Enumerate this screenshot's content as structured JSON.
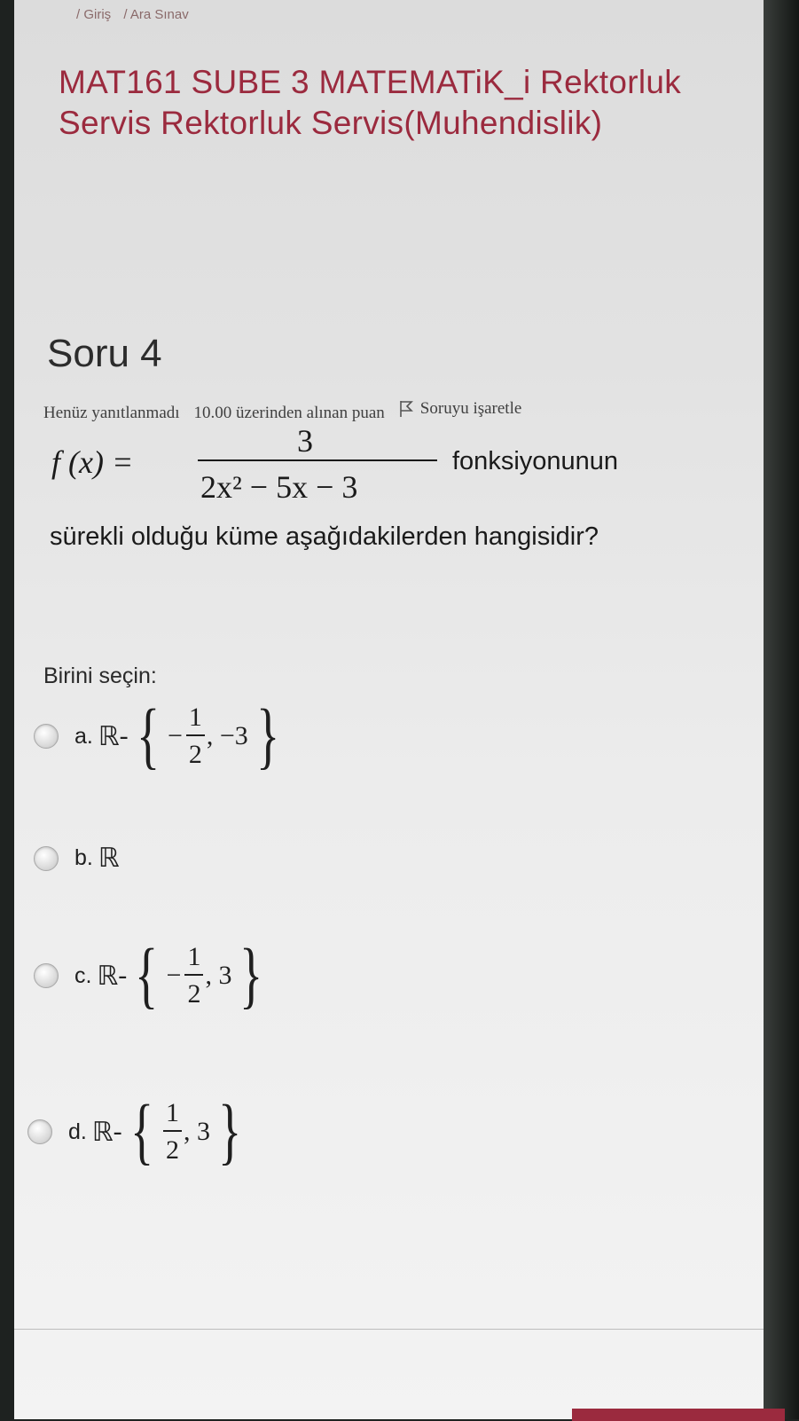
{
  "breadcrumb": {
    "items": [
      "/ Giriş",
      "/ Ara Sınav"
    ]
  },
  "course": {
    "title": "MAT161 SUBE 3 MATEMATiK_i Rektorluk Servis Rektorluk Servis(Muhendislik)"
  },
  "question": {
    "heading": "Soru 4",
    "status": "Henüz yanıtlanmadı",
    "points": "10.00 üzerinden alınan puan",
    "flag_label": "Soruyu işaretle",
    "formula": {
      "lhs": "f (x) =",
      "numerator": "3",
      "denominator": "2x² − 5x − 3",
      "trailing_text": "fonksiyonunun"
    },
    "text": "sürekli olduğu küme aşağıdakilerden hangisidir?"
  },
  "answers": {
    "prompt": "Birini seçin:",
    "options": [
      {
        "letter": "a.",
        "set": "ℝ",
        "sign": "-",
        "frac_sign": "−",
        "num": "1",
        "den": "2",
        "rest": ", −3"
      },
      {
        "letter": "b.",
        "set": "ℝ"
      },
      {
        "letter": "c.",
        "set": "ℝ",
        "sign": "-",
        "frac_sign": "−",
        "num": "1",
        "den": "2",
        "rest": ", 3"
      },
      {
        "letter": "d.",
        "set": "ℝ",
        "sign": "-",
        "frac_sign": "",
        "num": "1",
        "den": "2",
        "rest": ", 3"
      }
    ]
  },
  "colors": {
    "accent": "#9b2a3e",
    "text": "#1a1a1a"
  }
}
